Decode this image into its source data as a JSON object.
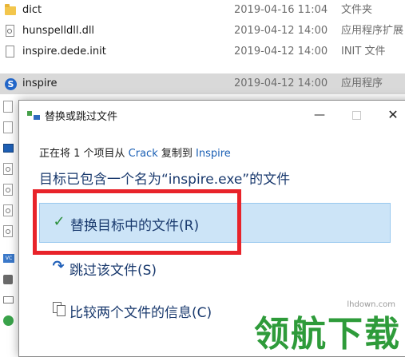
{
  "files": [
    {
      "name": "dict",
      "date": "2019-04-16 11:04",
      "type": "文件夹",
      "icon": "folder-icon"
    },
    {
      "name": "hunspelldll.dll",
      "date": "2019-04-12 14:00",
      "type": "应用程序扩展",
      "icon": "dll-file-icon"
    },
    {
      "name": "inspire.dede.init",
      "date": "2019-04-12 14:00",
      "type": "INIT 文件",
      "icon": "file-icon"
    },
    {
      "name": "inspire",
      "date": "2019-04-12 14:00",
      "type": "应用程序",
      "icon": "app-icon",
      "selected": true
    }
  ],
  "dialog": {
    "title": "替换或跳过文件",
    "progress_prefix": "正在将 1 个项目从 ",
    "source": "Crack",
    "progress_middle": " 复制到 ",
    "destination": "Inspire",
    "headline": "目标已包含一个名为“inspire.exe”的文件",
    "options": {
      "replace": "替换目标中的文件(R)",
      "skip": "跳过该文件(S)",
      "compare": "比较两个文件的信息(C)"
    },
    "minimize_glyph": "—",
    "close_glyph": "✕"
  },
  "watermark": {
    "url": "lhdown.com",
    "text": "领航下载"
  },
  "colors": {
    "accent_link": "#1a5fb4",
    "option_highlight": "#cce4f7",
    "annotation_red": "#e8232a",
    "watermark_green": "#2e9b3a"
  }
}
